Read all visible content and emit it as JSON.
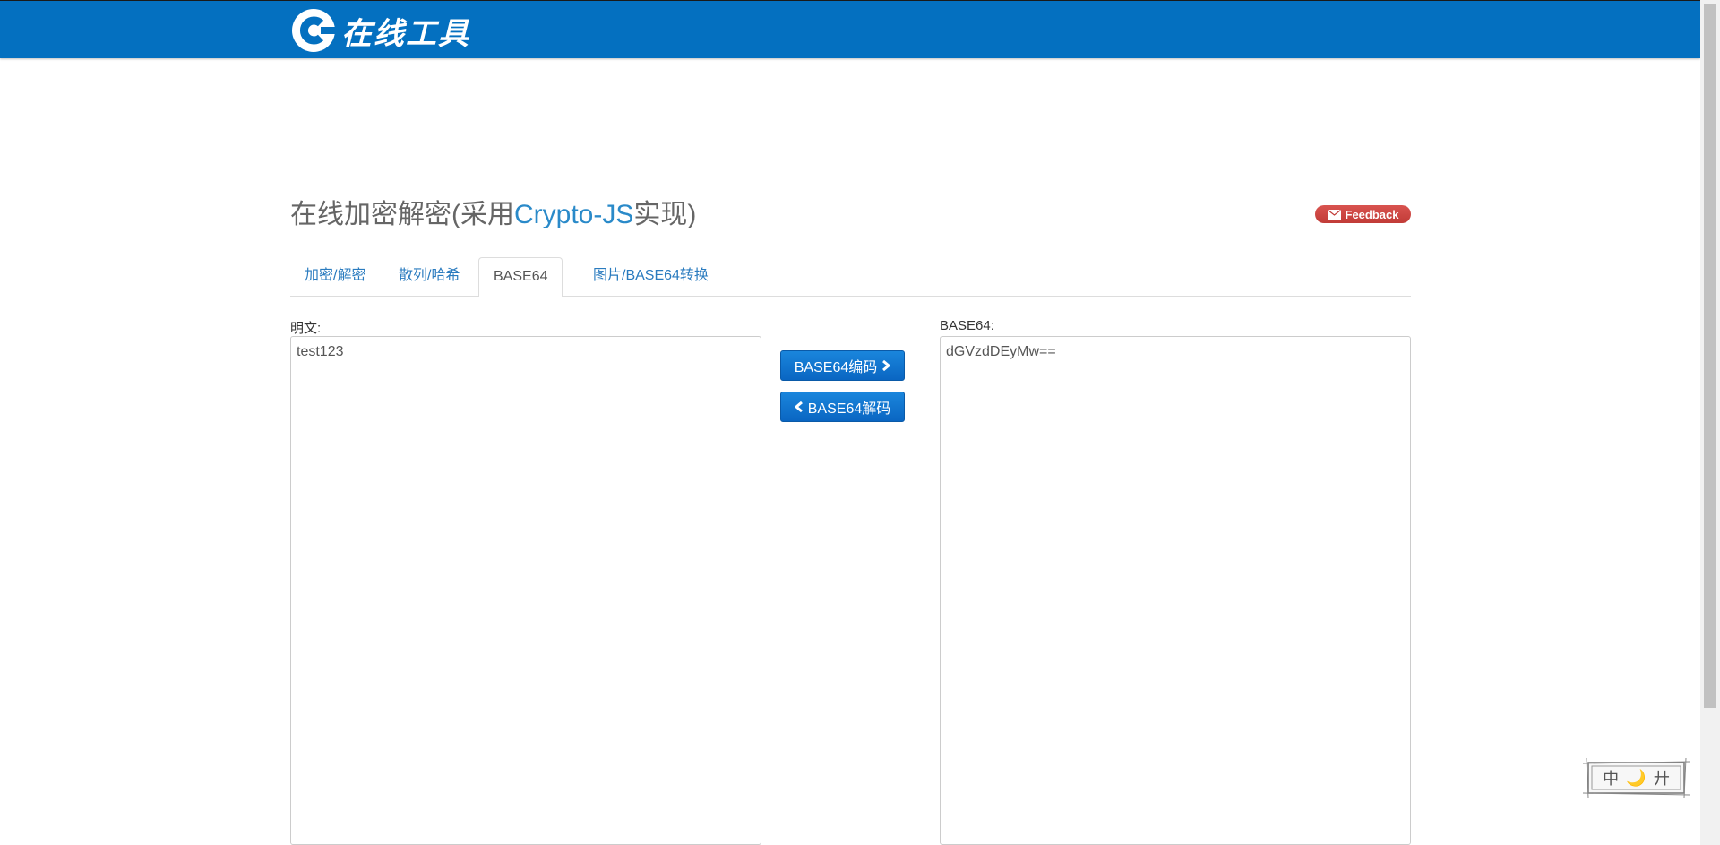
{
  "header": {
    "logo_text": "在线工具",
    "brand_color": "#0470c0"
  },
  "page": {
    "title_prefix": "在线加密解密(采用",
    "title_accent": "Crypto-JS",
    "title_suffix": "实现)",
    "feedback_label": "Feedback"
  },
  "tabs": [
    {
      "label": "加密/解密"
    },
    {
      "label": "散列/哈希"
    },
    {
      "label": "BASE64",
      "active": true
    },
    {
      "label": "图片/BASE64转换"
    }
  ],
  "plaintext": {
    "label": "明文:",
    "value": "test123"
  },
  "base64": {
    "label": "BASE64:",
    "value": "dGVzdDEyMw=="
  },
  "actions": {
    "encode_label": "BASE64编码",
    "decode_label": "BASE64解码"
  },
  "language_switch": {
    "chars": [
      "中",
      "🌙",
      "廾"
    ]
  }
}
